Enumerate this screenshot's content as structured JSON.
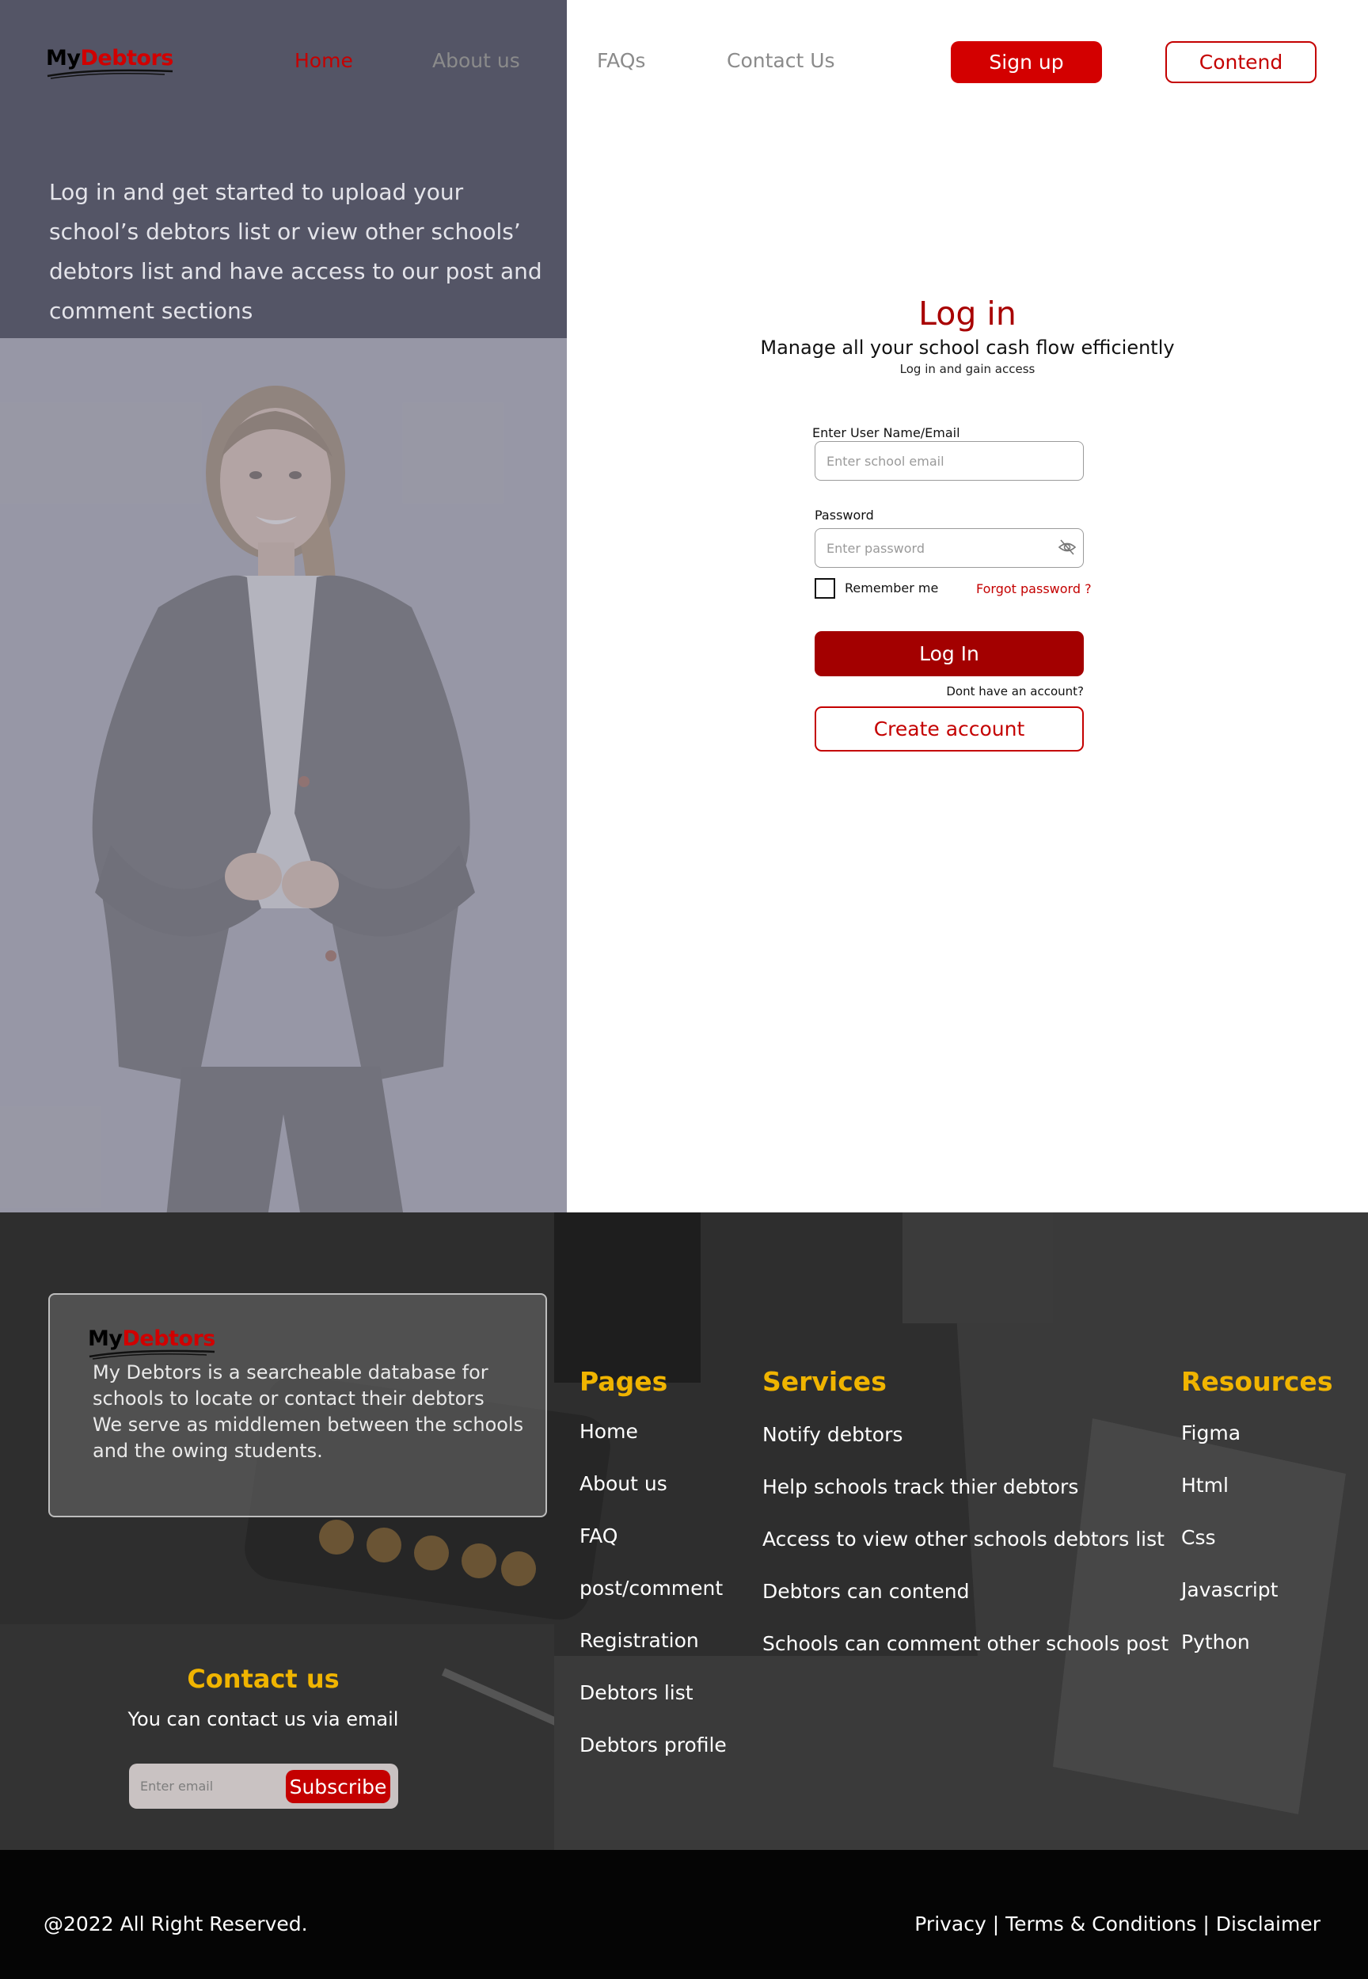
{
  "brand": {
    "logo_prefix": "My",
    "logo_suffix": "Debtors"
  },
  "nav": {
    "items": [
      "Home",
      "About us",
      "FAQs",
      "Contact Us"
    ],
    "signup_label": "Sign up",
    "contend_label": "Contend"
  },
  "hero": {
    "text": "Log in and get started to upload your school’s debtors list or view other schools’ debtors list and have access to our post and comment sections"
  },
  "login": {
    "title": "Log in",
    "subtitle": "Manage all your school cash flow efficiently",
    "subtitle2": "Log in and gain access",
    "email_label": "Enter User Name/Email",
    "email_placeholder": "Enter school email",
    "password_label": "Password",
    "password_placeholder": "Enter password",
    "remember_label": "Remember me",
    "forgot_label": "Forgot password ?",
    "login_button": "Log In",
    "no_account": "Dont have an account?",
    "create_button": "Create account"
  },
  "footer": {
    "about_lines": [
      "My Debtors is a searcheable database for",
      "schools to locate or contact their debtors",
      "We serve as middlemen between the schools",
      "and the owing students."
    ],
    "pages": {
      "title": "Pages",
      "items": [
        "Home",
        "About us",
        "FAQ",
        "post/comment",
        "Registration",
        "Debtors list",
        "Debtors profile"
      ]
    },
    "services": {
      "title": "Services",
      "items": [
        "Notify debtors",
        "Help schools track thier debtors",
        "Access to view other schools debtors list",
        "Debtors can contend",
        "Schools can comment other schools post"
      ]
    },
    "resources": {
      "title": "Resources",
      "items": [
        "Figma",
        "Html",
        "Css",
        "Javascript",
        "Python"
      ]
    },
    "contact": {
      "title": "Contact us",
      "subtitle": "You can contact us via email",
      "email_placeholder": "Enter email",
      "subscribe_label": "Subscribe"
    },
    "copyright": "@2022 All Right Reserved.",
    "legal": [
      "Privacy",
      "Terms & Conditions",
      "Disclaimer"
    ]
  },
  "colors": {
    "accent_red": "#d30000",
    "dark_red": "#a30000",
    "hero_panel": "#545566",
    "photo_overlay": "#9a9aa6",
    "footer_gold": "#f0b400"
  }
}
